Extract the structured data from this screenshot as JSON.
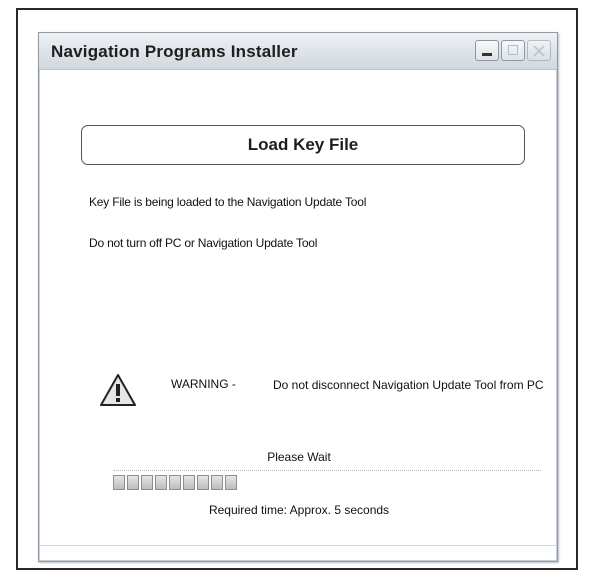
{
  "window": {
    "title": "Navigation Programs Installer"
  },
  "load_button": {
    "label": "Load Key File"
  },
  "status": {
    "line1": "Key File is being loaded to the Navigation Update Tool",
    "line2": "Do not turn off PC or Navigation Update Tool"
  },
  "warning": {
    "label": "WARNING -",
    "message": "Do not disconnect Navigation Update Tool from PC"
  },
  "progress": {
    "status_text": "Please Wait",
    "completed_blocks": 9,
    "required_time": "Required time: Approx. 5 seconds"
  },
  "icons": {
    "warning": "warning-triangle-icon",
    "minimize": "minimize-icon",
    "maximize": "maximize-icon",
    "close": "close-icon"
  },
  "colors": {
    "titlebar": "#dde3e8",
    "progress_block": "#bdbdbd"
  }
}
